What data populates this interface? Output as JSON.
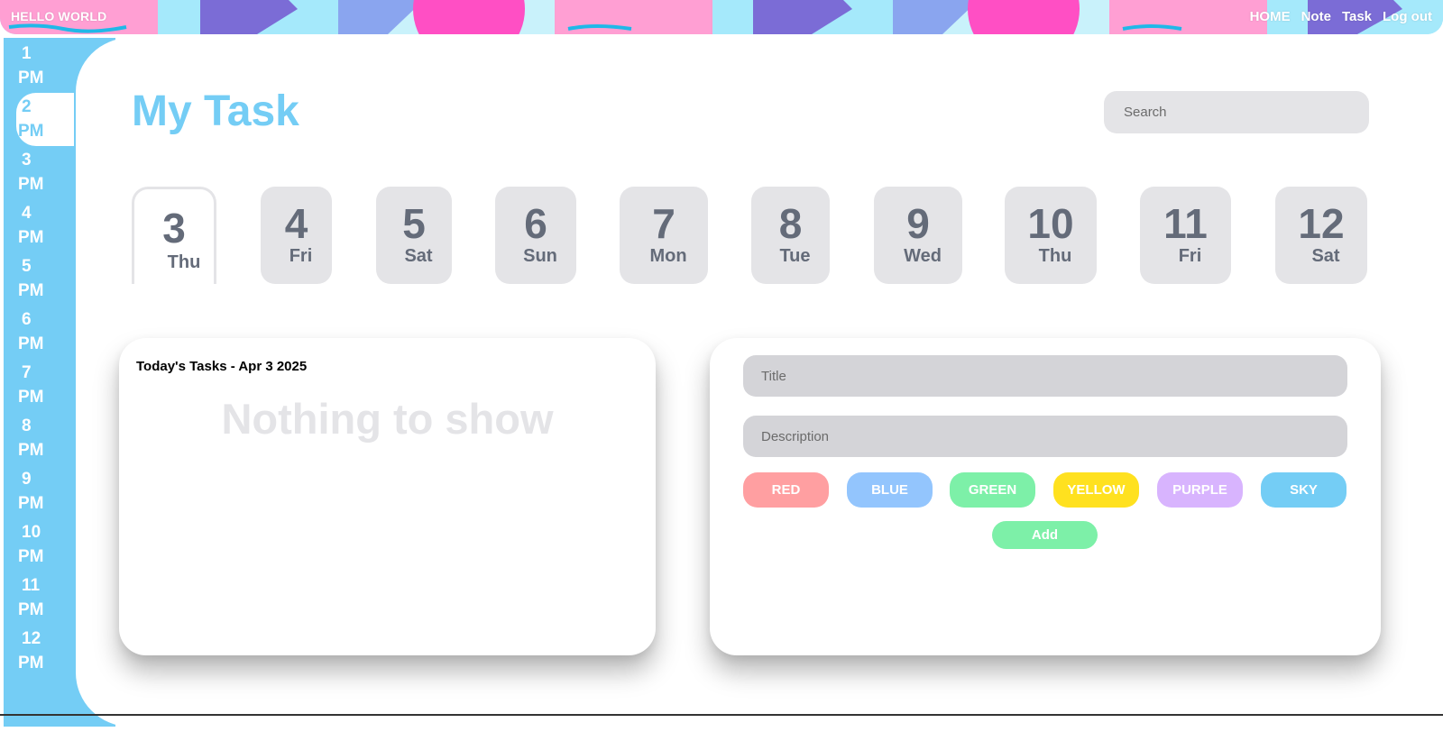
{
  "topbar": {
    "brand": "HELLO WORLD",
    "nav": [
      "HOME",
      "Note",
      "Task",
      "Log out"
    ]
  },
  "timeline": {
    "slots": [
      {
        "h": "1",
        "m": "PM"
      },
      {
        "h": "2",
        "m": "PM"
      },
      {
        "h": "3",
        "m": "PM"
      },
      {
        "h": "4",
        "m": "PM"
      },
      {
        "h": "5",
        "m": "PM"
      },
      {
        "h": "6",
        "m": "PM"
      },
      {
        "h": "7",
        "m": "PM"
      },
      {
        "h": "8",
        "m": "PM"
      },
      {
        "h": "9",
        "m": "PM"
      },
      {
        "h": "10",
        "m": "PM"
      },
      {
        "h": "11",
        "m": "PM"
      },
      {
        "h": "12",
        "m": "PM"
      }
    ],
    "active_index": 1
  },
  "header": {
    "title": "My Task",
    "search_placeholder": "Search"
  },
  "days": [
    {
      "num": "3",
      "dow": "Thu"
    },
    {
      "num": "4",
      "dow": "Fri"
    },
    {
      "num": "5",
      "dow": "Sat"
    },
    {
      "num": "6",
      "dow": "Sun"
    },
    {
      "num": "7",
      "dow": "Mon"
    },
    {
      "num": "8",
      "dow": "Tue"
    },
    {
      "num": "9",
      "dow": "Wed"
    },
    {
      "num": "10",
      "dow": "Thu"
    },
    {
      "num": "11",
      "dow": "Fri"
    },
    {
      "num": "12",
      "dow": "Sat"
    }
  ],
  "active_day_index": 0,
  "tasks_panel": {
    "heading": "Today's Tasks - Apr 3 2025",
    "empty_text": "Nothing to show"
  },
  "form": {
    "title_placeholder": "Title",
    "description_placeholder": "Description",
    "colors": [
      {
        "label": "RED",
        "color": "#ff9fa1"
      },
      {
        "label": "BLUE",
        "color": "#93c5fd"
      },
      {
        "label": "GREEN",
        "color": "#7df0a8"
      },
      {
        "label": "YELLOW",
        "color": "#ffe11f"
      },
      {
        "label": "PURPLE",
        "color": "#d8b4fe"
      },
      {
        "label": "SKY",
        "color": "#74cdf5"
      }
    ],
    "add_label": "Add",
    "add_color": "#7df0a8"
  },
  "theme": {
    "accent": "#74cdf5",
    "muted_bg": "#e4e4e7",
    "day_text": "#646b79"
  }
}
